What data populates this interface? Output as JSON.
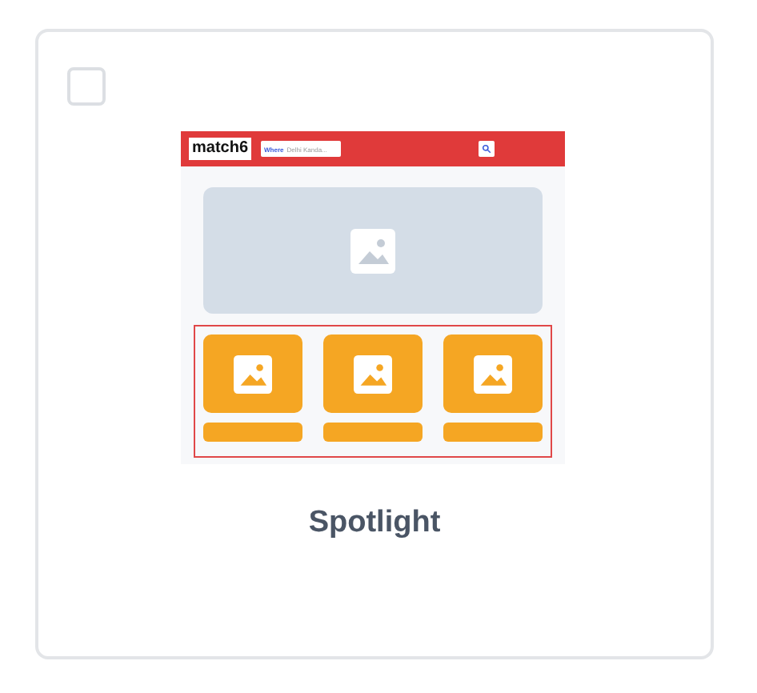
{
  "checkbox": {
    "checked": false
  },
  "preview": {
    "logo": "match6",
    "search_label": "Where",
    "search_placeholder": "Delhi Kanda..."
  },
  "title": "Spotlight"
}
